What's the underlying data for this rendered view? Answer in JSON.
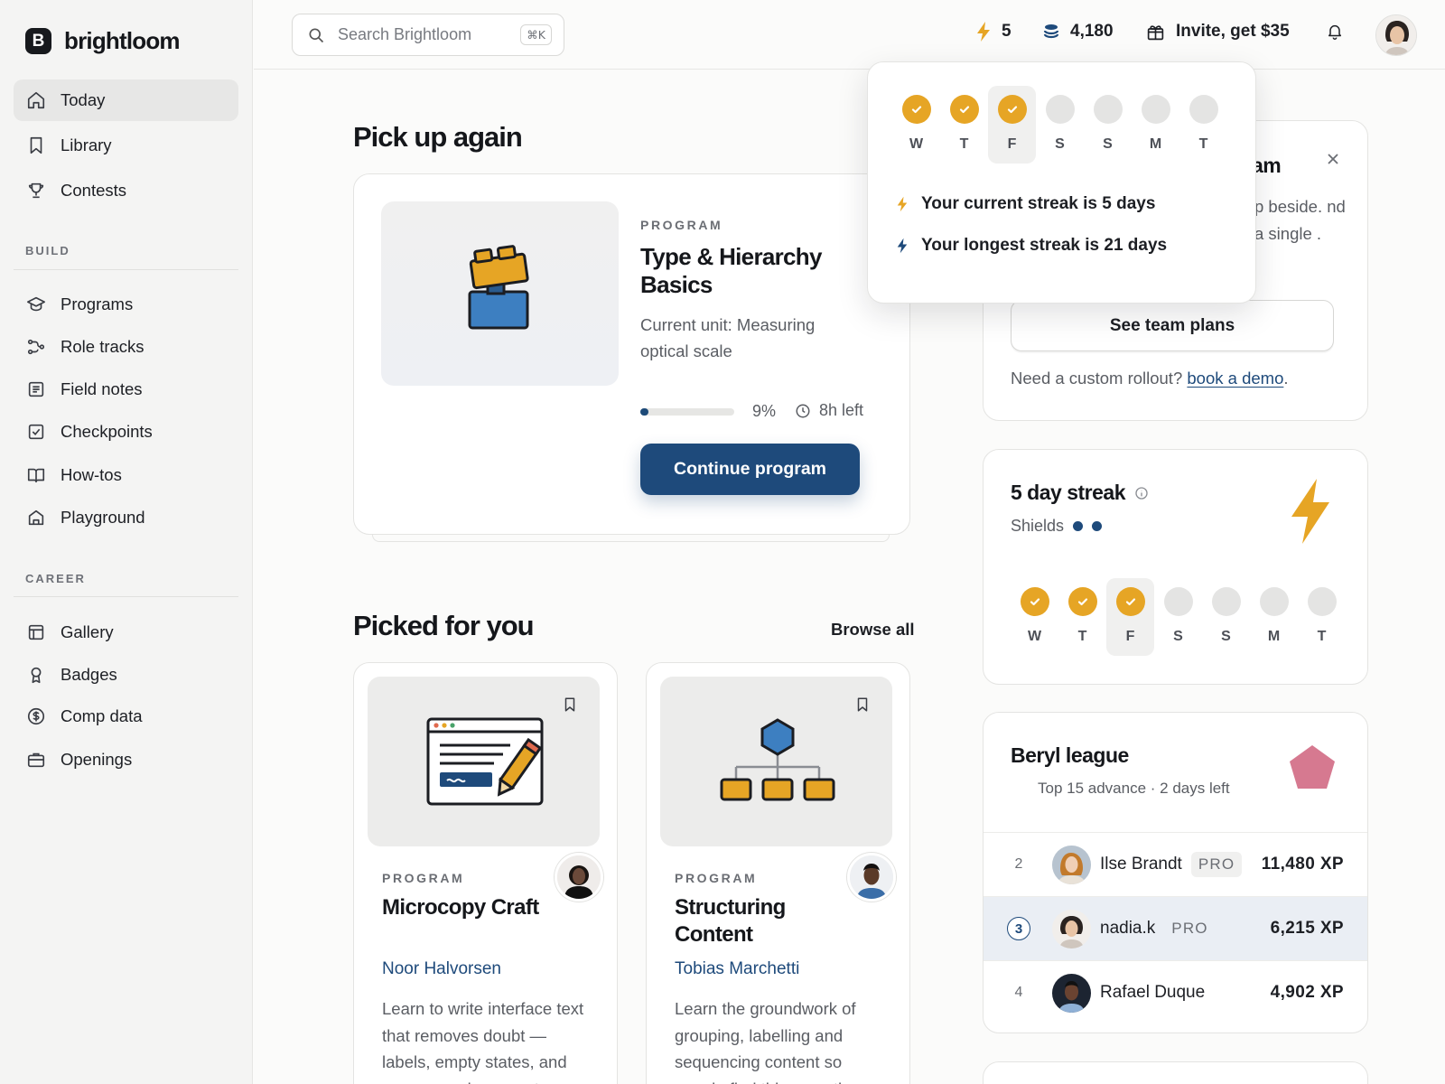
{
  "brand": {
    "mark": "B",
    "name": "brightloom"
  },
  "nav": {
    "main": [
      {
        "label": "Today",
        "icon": "home-icon",
        "active": true
      },
      {
        "label": "Library",
        "icon": "bookmark-icon"
      },
      {
        "label": "Contests",
        "icon": "trophy-icon"
      }
    ],
    "build_heading": "BUILD",
    "build": [
      {
        "label": "Programs",
        "icon": "graduation-cap-icon"
      },
      {
        "label": "Role tracks",
        "icon": "route-icon"
      },
      {
        "label": "Field notes",
        "icon": "notes-icon"
      },
      {
        "label": "Checkpoints",
        "icon": "checkbox-icon"
      },
      {
        "label": "How-tos",
        "icon": "open-book-icon"
      },
      {
        "label": "Playground",
        "icon": "house-icon"
      }
    ],
    "career_heading": "CAREER",
    "career": [
      {
        "label": "Gallery",
        "icon": "layout-icon"
      },
      {
        "label": "Badges",
        "icon": "award-icon"
      },
      {
        "label": "Comp data",
        "icon": "dollar-circle-icon"
      },
      {
        "label": "Openings",
        "icon": "briefcase-icon"
      }
    ]
  },
  "topbar": {
    "search_placeholder": "Search Brightloom",
    "search_shortcut": "⌘K",
    "streak_count": "5",
    "coins": "4,180",
    "invite": "Invite, get $35"
  },
  "pickup": {
    "heading": "Pick up again",
    "eyebrow": "PROGRAM",
    "title": "Type & Hierarchy Basics",
    "unit": "Current unit: Measuring optical scale",
    "progress_percent": 9,
    "progress_label": "9%",
    "time_left": "8h left",
    "cta": "Continue program"
  },
  "picked": {
    "heading": "Picked for you",
    "browse": "Browse all",
    "cards": [
      {
        "eyebrow": "PROGRAM",
        "title": "Microcopy Craft",
        "author": "Noor Halvorsen",
        "desc": "Learn to write interface text that removes doubt — labels, empty states, and errors people can act on."
      },
      {
        "eyebrow": "PROGRAM",
        "title": "Structuring Content",
        "author": "Tobias Marchetti",
        "desc": "Learn the groundwork of grouping, labelling and sequencing content so people find things on the"
      }
    ]
  },
  "team": {
    "title": "am",
    "desc": "p beside. nd a single .",
    "cta": "See team plans",
    "rollout_text": "Need a custom rollout?",
    "rollout_link": "book a demo",
    "rollout_end": "."
  },
  "streak": {
    "title": "5 day streak",
    "shields_label": "Shields",
    "shields": 2,
    "accent": "#e6a525",
    "days": [
      {
        "label": "W",
        "done": true
      },
      {
        "label": "T",
        "done": true
      },
      {
        "label": "F",
        "done": true,
        "today": true
      },
      {
        "label": "S",
        "done": false
      },
      {
        "label": "S",
        "done": false
      },
      {
        "label": "M",
        "done": false
      },
      {
        "label": "T",
        "done": false
      }
    ]
  },
  "popover": {
    "current": "Your current streak is 5 days",
    "longest": "Your longest streak is 21 days"
  },
  "league": {
    "title": "Beryl league",
    "subtitle": "Top 15 advance · 2 days left",
    "gem_color": "#d67990",
    "rows": [
      {
        "rank": "2",
        "name": "Ilse Brandt",
        "pro": "PRO",
        "xp": "11,480 XP"
      },
      {
        "rank": "3",
        "name": "nadia.k",
        "pro": "PRO",
        "xp": "6,215 XP",
        "me": true
      },
      {
        "rank": "4",
        "name": "Rafael Duque",
        "pro": "",
        "xp": "4,902 XP"
      }
    ]
  }
}
